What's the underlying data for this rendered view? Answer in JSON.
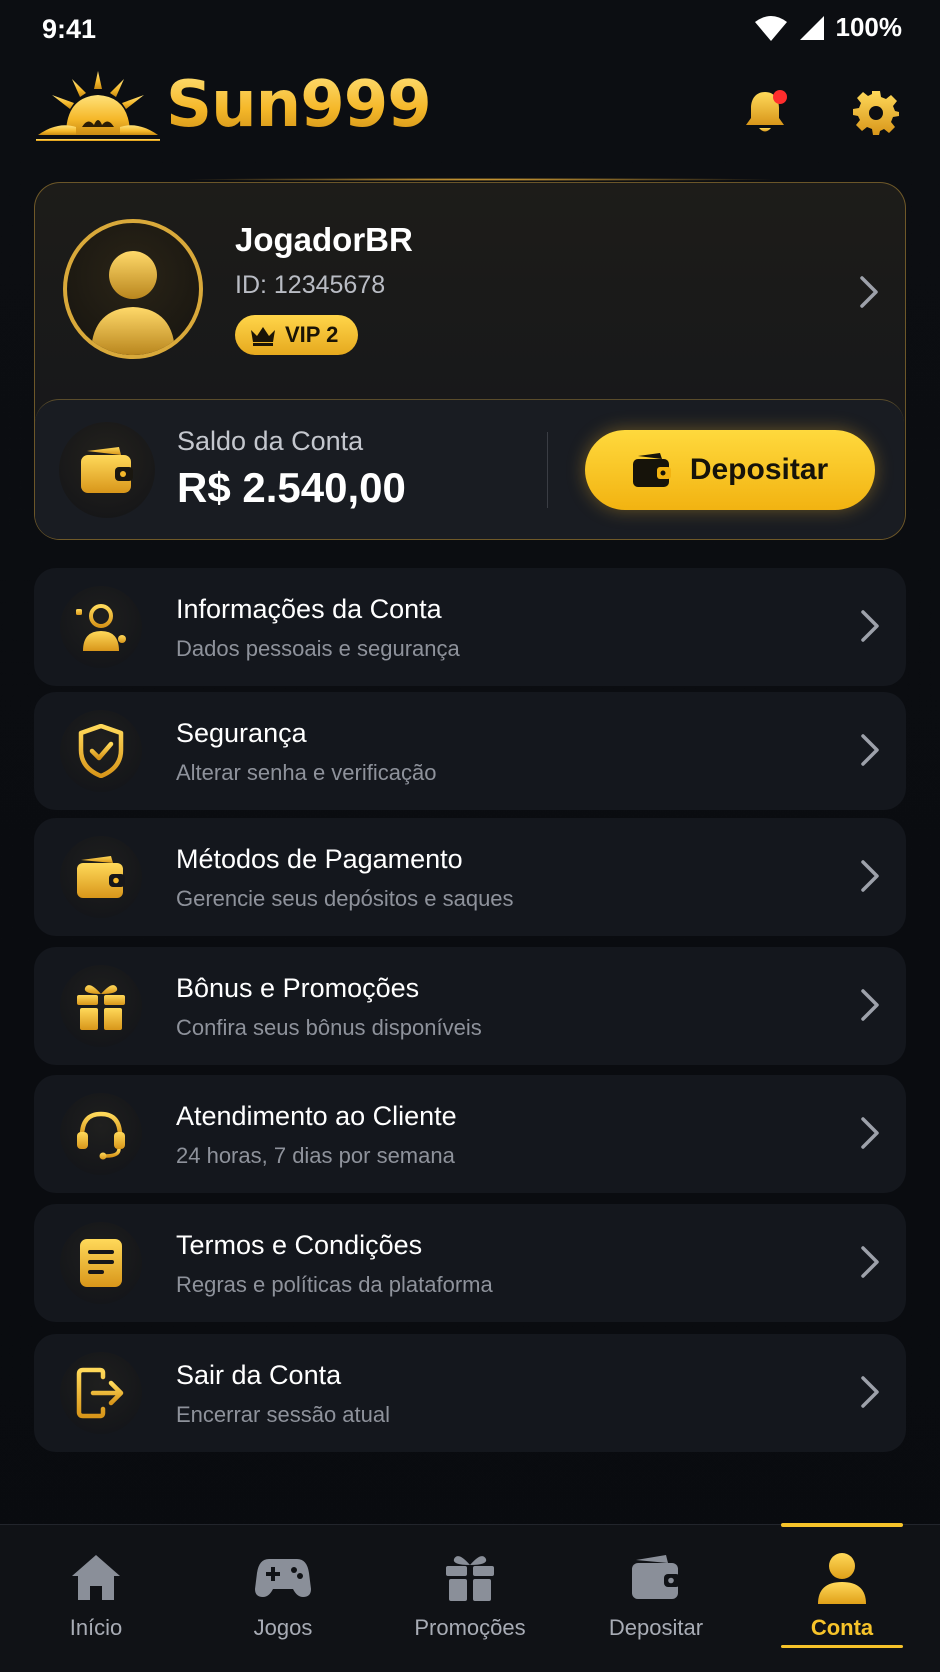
{
  "status_bar": {
    "time": "9:41",
    "battery": "100%"
  },
  "header": {
    "logo_text": "Sun999",
    "notification_dot": true
  },
  "profile": {
    "username": "JogadorBR",
    "id_text": "ID: 12345678",
    "vip_label": "VIP 2"
  },
  "balance": {
    "label": "Saldo da Conta",
    "value": "R$ 2.540,00",
    "deposit_label": "Depositar"
  },
  "menu": [
    {
      "title": "Informações da Conta",
      "subtitle": "Dados pessoais e segurança",
      "icon": "user-info-icon"
    },
    {
      "title": "Segurança",
      "subtitle": "Alterar senha e verificação",
      "icon": "shield-check-icon"
    },
    {
      "title": "Métodos de Pagamento",
      "subtitle": "Gerencie seus depósitos e saques",
      "icon": "wallet-icon"
    },
    {
      "title": "Bônus e Promoções",
      "subtitle": "Confira seus bônus disponíveis",
      "icon": "gift-icon"
    },
    {
      "title": "Atendimento ao Cliente",
      "subtitle": "24 horas, 7 dias por semana",
      "icon": "headset-icon"
    },
    {
      "title": "Termos e Condições",
      "subtitle": "Regras e políticas da plataforma",
      "icon": "document-icon"
    },
    {
      "title": "Sair da Conta",
      "subtitle": "Encerrar sessão atual",
      "icon": "logout-icon"
    }
  ],
  "bottom_nav": [
    {
      "label": "Início",
      "icon": "home-icon",
      "active": false
    },
    {
      "label": "Jogos",
      "icon": "gamepad-icon",
      "active": false
    },
    {
      "label": "Promoções",
      "icon": "gift-icon",
      "active": false
    },
    {
      "label": "Depositar",
      "icon": "wallet-icon",
      "active": false
    },
    {
      "label": "Conta",
      "icon": "user-icon",
      "active": true
    }
  ],
  "colors": {
    "accent_gold": "#f6c32a",
    "background": "#0b0d11",
    "card": "#14171d",
    "notification": "#ff2d2d"
  }
}
